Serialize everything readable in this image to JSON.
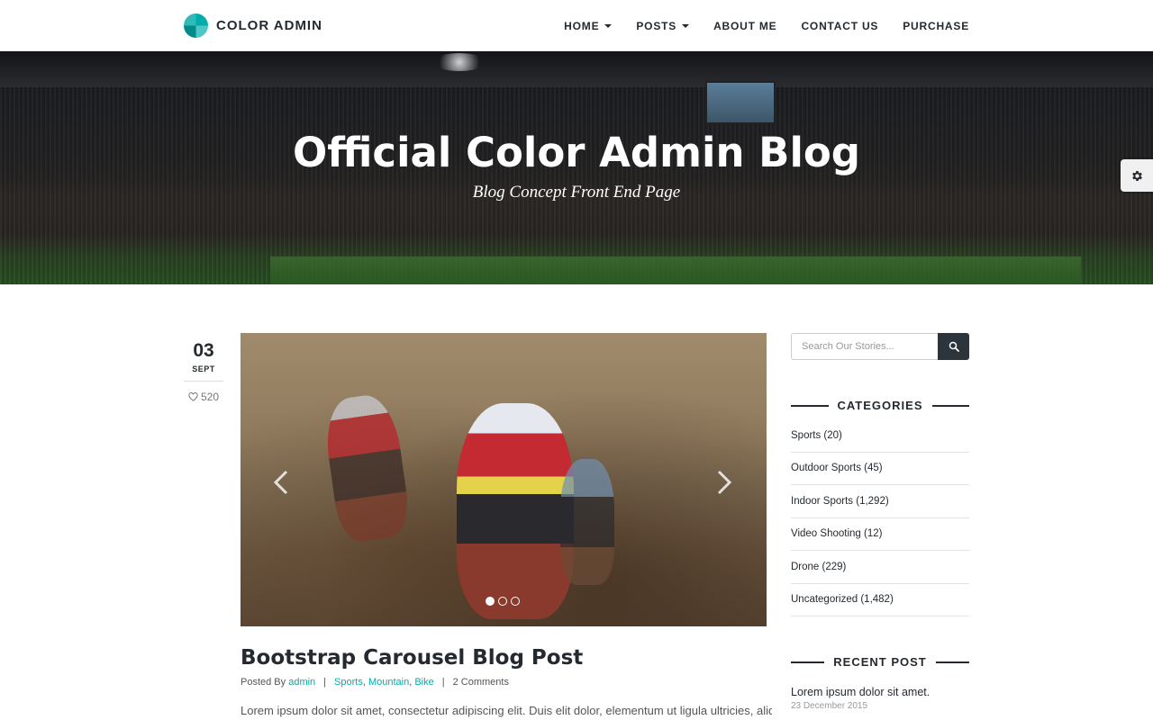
{
  "header": {
    "brand": "COLOR ADMIN",
    "nav": [
      {
        "label": "HOME",
        "dropdown": true
      },
      {
        "label": "POSTS",
        "dropdown": true
      },
      {
        "label": "ABOUT ME",
        "dropdown": false
      },
      {
        "label": "CONTACT US",
        "dropdown": false
      },
      {
        "label": "PURCHASE",
        "dropdown": false
      }
    ]
  },
  "hero": {
    "title": "Official Color Admin Blog",
    "subtitle": "Blog Concept Front End Page"
  },
  "post": {
    "day": "03",
    "month": "SEPT",
    "likes": "520",
    "title": "Bootstrap Carousel Blog Post",
    "posted_by_label": "Posted By",
    "author": "admin",
    "tags": [
      "Sports",
      "Mountain",
      "Bike"
    ],
    "comments": "2 Comments",
    "excerpt": "Lorem ipsum dolor sit amet, consectetur adipiscing elit. Duis elit dolor, elementum ut ligula ultricies, aliquet",
    "carousel": {
      "slides": 3,
      "active_index": 0
    }
  },
  "sidebar": {
    "search_placeholder": "Search Our Stories...",
    "categories_title": "CATEGORIES",
    "categories": [
      {
        "label": "Sports (20)"
      },
      {
        "label": "Outdoor Sports (45)"
      },
      {
        "label": "Indoor Sports (1,292)"
      },
      {
        "label": "Video Shooting (12)"
      },
      {
        "label": "Drone (229)"
      },
      {
        "label": "Uncategorized (1,482)"
      }
    ],
    "recent_title": "RECENT POST",
    "recent_posts": [
      {
        "title": "Lorem ipsum dolor sit amet.",
        "date": "23 December 2015"
      }
    ]
  },
  "icons": {
    "settings": "gear-icon",
    "search": "search-icon",
    "like": "heart-icon",
    "prev": "chevron-left-icon",
    "next": "chevron-right-icon"
  },
  "colors": {
    "accent": "#00acac",
    "dark": "#242a30",
    "search_button": "#2d353c"
  }
}
